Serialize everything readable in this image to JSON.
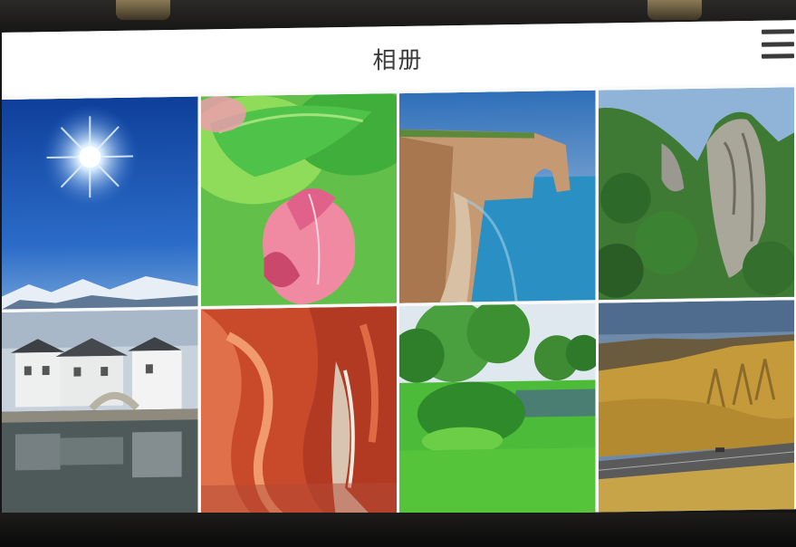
{
  "app": {
    "title": "相册"
  },
  "header": {
    "menu_icon": "hamburger-menu-icon"
  },
  "gallery": {
    "photos": [
      {
        "subject": "sun-sky"
      },
      {
        "subject": "lotus-bud"
      },
      {
        "subject": "sea-arch-cliff"
      },
      {
        "subject": "green-karst-cliff"
      },
      {
        "subject": "water-town"
      },
      {
        "subject": "red-canyon"
      },
      {
        "subject": "green-park"
      },
      {
        "subject": "golden-hills"
      }
    ]
  },
  "colors": {
    "topbar_bg": "#ffffff",
    "title_text": "#3c3c3c",
    "menu_icon": "#3a3a3a"
  }
}
